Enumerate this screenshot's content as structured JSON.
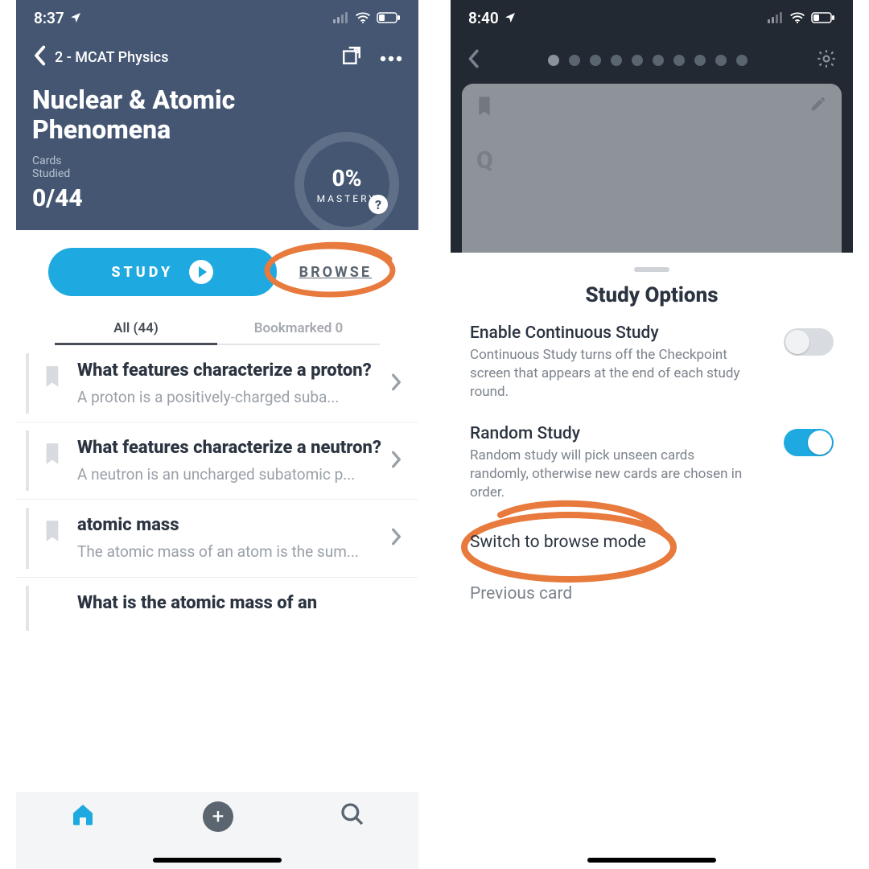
{
  "left": {
    "status": {
      "time": "8:37"
    },
    "nav": {
      "back_title": "2 - MCAT Physics"
    },
    "deck": {
      "title_line1": "Nuclear & Atomic",
      "title_line2": "Phenomena",
      "cards_label_line1": "Cards",
      "cards_label_line2": "Studied",
      "cards_count": "0/44",
      "mastery_pct": "0%",
      "mastery_label": "MASTERY"
    },
    "pills": {
      "study": "STUDY",
      "browse": "BROWSE"
    },
    "tabs": {
      "all": "All (44)",
      "bookmarked": "Bookmarked 0"
    },
    "cards": [
      {
        "q": "What features characterize a proton?",
        "a": "A proton is a positively-charged suba..."
      },
      {
        "q": "What features characterize a neutron?",
        "a": "A neutron is an uncharged subatomic p..."
      },
      {
        "q": "atomic mass",
        "a": "The atomic mass of an atom is the sum..."
      },
      {
        "q": "What is the atomic mass of an",
        "a": ""
      }
    ]
  },
  "right": {
    "status": {
      "time": "8:40"
    },
    "progress_dots": 10,
    "sheet": {
      "title": "Study Options",
      "opts": [
        {
          "title": "Enable Continuous Study",
          "desc": "Continuous Study turns off the Checkpoint screen that appears at the end of each study round.",
          "on": false
        },
        {
          "title": "Random Study",
          "desc": "Random study will pick unseen cards randomly, otherwise new cards are chosen in order.",
          "on": true
        }
      ],
      "switch_browse": "Switch to browse mode",
      "previous": "Previous card"
    }
  },
  "help_glyph": "?",
  "plus_glyph": "+",
  "q_glyph": "Q"
}
